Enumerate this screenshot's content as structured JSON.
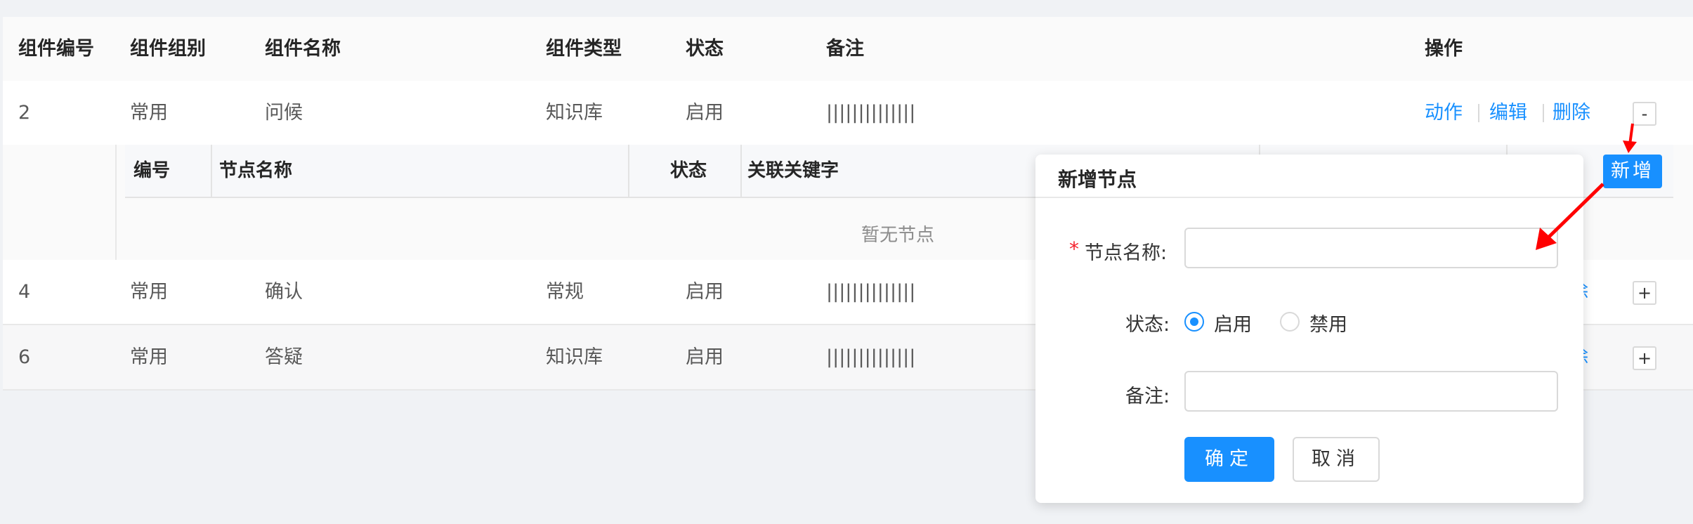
{
  "table": {
    "columns": [
      "组件编号",
      "组件组别",
      "组件名称",
      "组件类型",
      "状态",
      "备注",
      "操作"
    ],
    "rows": [
      {
        "id": "2",
        "group": "常用",
        "name": "问候",
        "type": "知识库",
        "status": "启用",
        "remark": "||||||||||||||",
        "expand": "-"
      },
      {
        "id": "4",
        "group": "常用",
        "name": "确认",
        "type": "常规",
        "status": "启用",
        "remark": "||||||||||||||",
        "expand": "+"
      },
      {
        "id": "6",
        "group": "常用",
        "name": "答疑",
        "type": "知识库",
        "status": "启用",
        "remark": "||||||||||||||",
        "expand": "+"
      }
    ],
    "actions": {
      "action": "动作",
      "edit": "编辑",
      "delete": "删除",
      "delete_clipped": "除"
    }
  },
  "subtable": {
    "columns": [
      "编号",
      "节点名称",
      "状态",
      "关联关键字"
    ],
    "empty": "暂无节点",
    "add_button": "新增"
  },
  "popover": {
    "title": "新增节点",
    "required_mark": "*",
    "name_label": "节点名称:",
    "name_value": "",
    "status_label": "状态:",
    "status_options": [
      "启用",
      "禁用"
    ],
    "status_selected": "启用",
    "remark_label": "备注:",
    "remark_value": "",
    "confirm": "确定",
    "cancel": "取消"
  },
  "colors": {
    "primary": "#1890ff",
    "arrow": "#ff0000",
    "required": "#f5222d"
  }
}
